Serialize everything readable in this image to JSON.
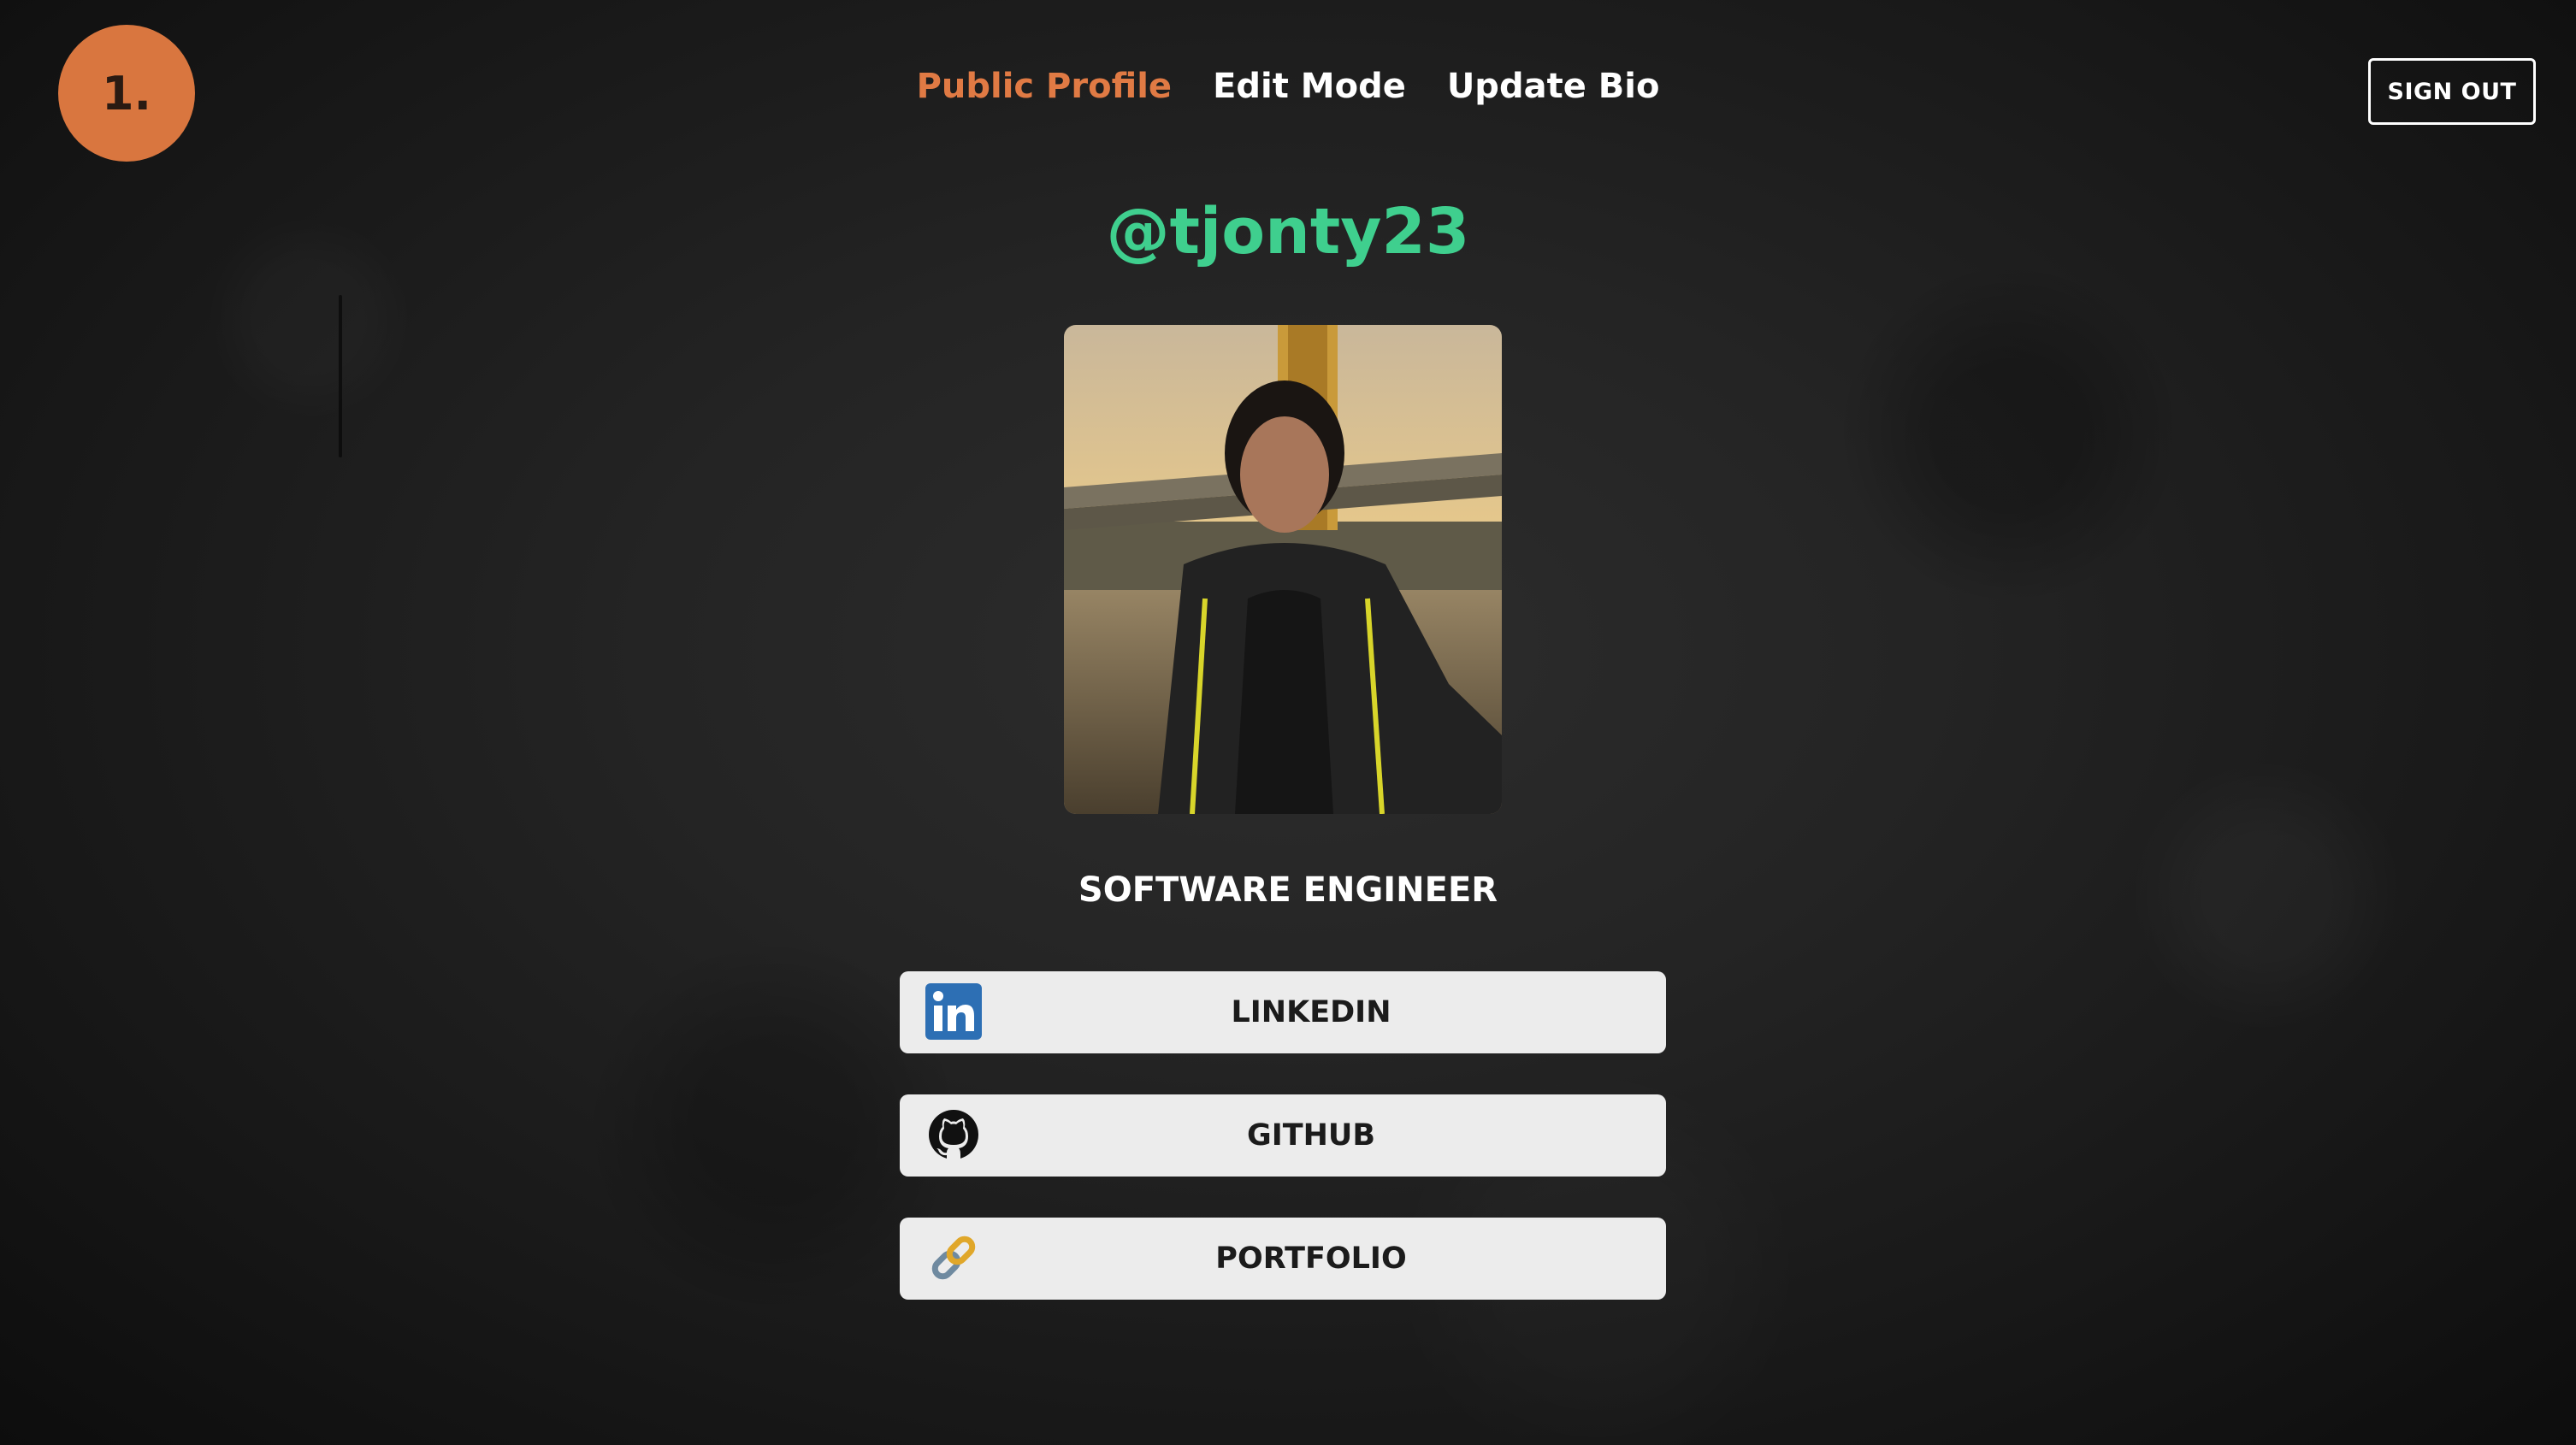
{
  "brand": {
    "logo_text": "1.",
    "logo_color": "#d9763f"
  },
  "nav": {
    "items": [
      {
        "label": "Public Profile",
        "active": true
      },
      {
        "label": "Edit Mode",
        "active": false
      },
      {
        "label": "Update Bio",
        "active": false
      }
    ],
    "active_color": "#e07a44"
  },
  "header": {
    "sign_out_label": "SIGN OUT"
  },
  "profile": {
    "handle": "@tjonty23",
    "handle_color": "#3fcf8e",
    "title": "SOFTWARE ENGINEER",
    "photo_icon": "profile-photo"
  },
  "links": [
    {
      "label": "LINKEDIN",
      "icon": "linkedin-icon"
    },
    {
      "label": "GITHUB",
      "icon": "github-icon"
    },
    {
      "label": "PORTFOLIO",
      "icon": "link-icon"
    }
  ]
}
